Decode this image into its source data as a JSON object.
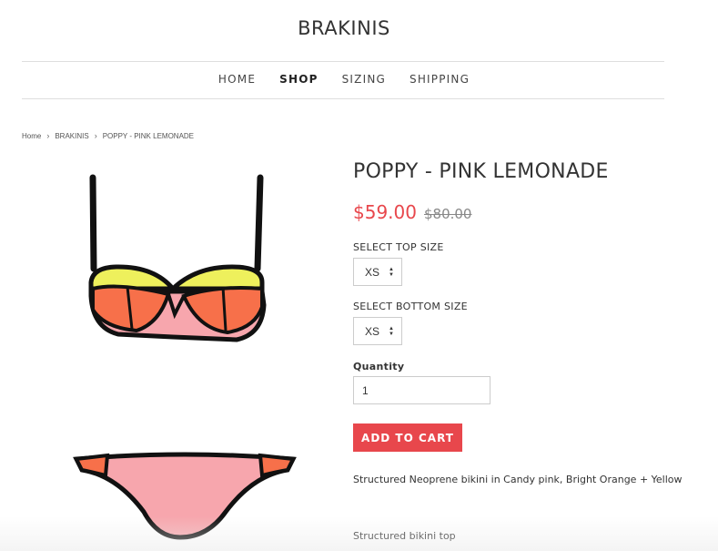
{
  "site": {
    "title": "BRAKINIS"
  },
  "nav": {
    "items": [
      {
        "label": "HOME",
        "active": false
      },
      {
        "label": "SHOP",
        "active": true
      },
      {
        "label": "SIZING",
        "active": false
      },
      {
        "label": "SHIPPING",
        "active": false
      }
    ]
  },
  "breadcrumb": {
    "items": [
      "Home",
      "BRAKINIS",
      "POPPY - PINK LEMONADE"
    ],
    "separator": "›"
  },
  "product": {
    "title": "POPPY - PINK LEMONADE",
    "price": "$59.00",
    "compare_price": "$80.00",
    "top_size": {
      "label": "SELECT TOP SIZE",
      "value": "XS"
    },
    "bottom_size": {
      "label": "SELECT BOTTOM SIZE",
      "value": "XS"
    },
    "quantity": {
      "label": "Quantity",
      "value": "1"
    },
    "add_to_cart": "ADD TO CART",
    "description": "Structured Neoprene bikini in Candy pink, Bright Orange + Yellow",
    "detail": "Structured bikini top",
    "images": [
      "bikini-top",
      "bikini-bottom"
    ]
  },
  "colors": {
    "accent": "#e8474c",
    "candy_pink": "#f7a6ad",
    "bright_orange": "#f7704a",
    "yellow": "#eef05c",
    "trim": "#111111"
  }
}
